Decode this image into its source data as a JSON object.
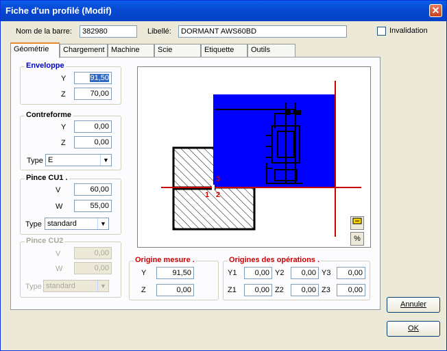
{
  "window": {
    "title": "Fiche d'un profilé (Modif)",
    "close_glyph": "✕"
  },
  "header": {
    "nom_label": "Nom de la barre:",
    "nom_value": "382980",
    "libelle_label": "Libellé:",
    "libelle_value": "DORMANT  AWS60BD",
    "invalidation_label": "Invalidation"
  },
  "tabs": [
    "Géométrie",
    "Chargement",
    "Machine",
    "Scie",
    "Etiquette",
    "Outils"
  ],
  "enveloppe": {
    "title": "Enveloppe",
    "y_label": "Y",
    "y_value": "91,50",
    "z_label": "Z",
    "z_value": "70,00"
  },
  "contreforme": {
    "title": "Contreforme",
    "y_label": "Y",
    "y_value": "0,00",
    "z_label": "Z",
    "z_value": "0,00",
    "type_label": "Type",
    "type_value": "E"
  },
  "pince_cu1": {
    "title": "Pince CU1 .",
    "v_label": "V",
    "v_value": "60,00",
    "w_label": "W",
    "w_value": "55,00",
    "type_label": "Type",
    "type_value": "standard"
  },
  "pince_cu2": {
    "title": "Pince CU2",
    "v_label": "V",
    "v_value": "0,00",
    "w_label": "W",
    "w_value": "0,00",
    "type_label": "Type",
    "type_value": "standard"
  },
  "origine_mesure": {
    "title": "Origine mesure .",
    "y_label": "Y",
    "y_value": "91,50",
    "z_label": "Z",
    "z_value": "0,00"
  },
  "origines_operations": {
    "title": "Origines des opérations .",
    "fields": [
      {
        "label": "Y1",
        "value": "0,00"
      },
      {
        "label": "Y2",
        "value": "0,00"
      },
      {
        "label": "Y3",
        "value": "0,00"
      },
      {
        "label": "Z1",
        "value": "0,00"
      },
      {
        "label": "Z2",
        "value": "0,00"
      },
      {
        "label": "Z3",
        "value": "0,00"
      }
    ]
  },
  "drawing": {
    "point_labels": [
      "1",
      "2",
      "3"
    ],
    "colors": {
      "envelope": "#0000ff",
      "axes": "#cc0000",
      "hatch": "#000000"
    },
    "zoom_icon": "zoom-icon",
    "percent_label": "%"
  },
  "buttons": {
    "annuler": "Annuler",
    "ok": "OK"
  }
}
